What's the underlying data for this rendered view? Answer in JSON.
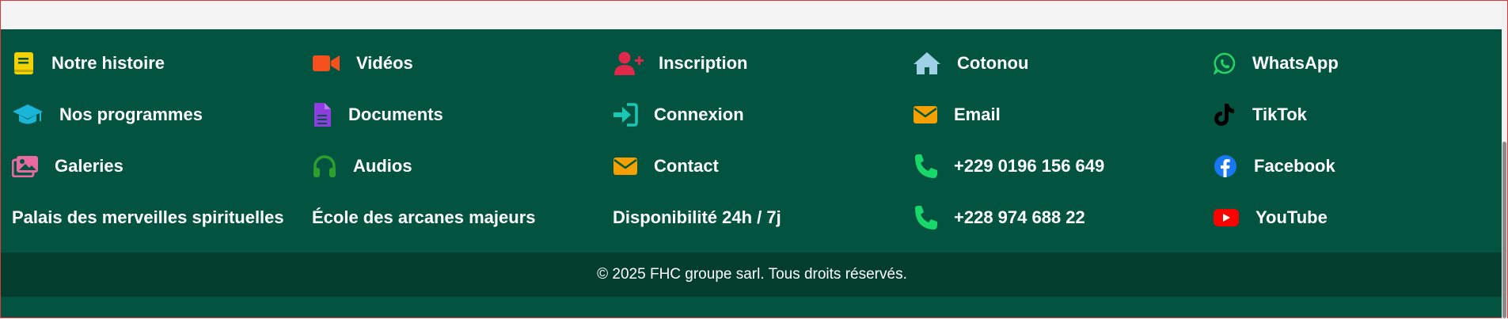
{
  "columns": [
    {
      "items": [
        {
          "label": "Notre histoire",
          "icon": "book-icon",
          "color": "#f2d200"
        },
        {
          "label": "Nos programmes",
          "icon": "graduation-cap-icon",
          "color": "#1ab6d9"
        },
        {
          "label": "Galeries",
          "icon": "images-icon",
          "color": "#e86aa0"
        },
        {
          "label": "Palais des merveilles spirituelles",
          "icon": "",
          "color": ""
        }
      ]
    },
    {
      "items": [
        {
          "label": "Vidéos",
          "icon": "video-icon",
          "color": "#f4511e"
        },
        {
          "label": "Documents",
          "icon": "document-icon",
          "color": "#8e3de0"
        },
        {
          "label": "Audios",
          "icon": "headphones-icon",
          "color": "#2e9e2e"
        },
        {
          "label": "École des arcanes majeurs",
          "icon": "",
          "color": ""
        }
      ]
    },
    {
      "items": [
        {
          "label": "Inscription",
          "icon": "user-plus-icon",
          "color": "#e0284a"
        },
        {
          "label": "Connexion",
          "icon": "sign-in-icon",
          "color": "#1bc6b4"
        },
        {
          "label": "Contact",
          "icon": "envelope-icon",
          "color": "#f5a000"
        },
        {
          "label": "Disponibilité 24h / 7j",
          "icon": "",
          "color": ""
        }
      ]
    },
    {
      "items": [
        {
          "label": "Cotonou",
          "icon": "home-icon",
          "color": "#9fd1e6"
        },
        {
          "label": "Email",
          "icon": "envelope-icon",
          "color": "#f5a000"
        },
        {
          "label": "+229 0196 156 649",
          "icon": "phone-icon",
          "color": "#18d86a"
        },
        {
          "label": "+228 974 688 22",
          "icon": "phone-icon",
          "color": "#18d86a"
        }
      ]
    },
    {
      "items": [
        {
          "label": "WhatsApp",
          "icon": "whatsapp-icon",
          "color": "#25d366"
        },
        {
          "label": "TikTok",
          "icon": "tiktok-icon",
          "color": "#000000"
        },
        {
          "label": "Facebook",
          "icon": "facebook-icon",
          "color": "#1877f2"
        },
        {
          "label": "YouTube",
          "icon": "youtube-icon",
          "color": "#ff0000"
        }
      ]
    }
  ],
  "footer": {
    "copyright": "© 2025 FHC groupe sarl. Tous droits réservés."
  },
  "colors": {
    "footer_bg": "#025440",
    "bottom_bar_bg": "#023d2e",
    "text": "#ffffff"
  }
}
